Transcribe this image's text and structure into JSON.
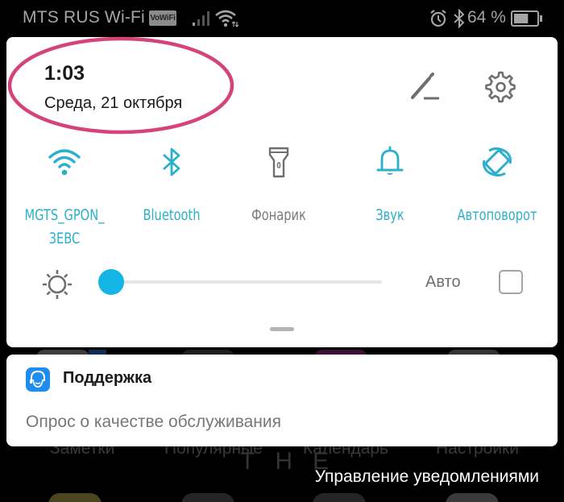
{
  "status_bar": {
    "carrier": "MTS RUS Wi-Fi",
    "vowifi_badge": "VoWiFi",
    "battery_percent_text": "64 %",
    "battery_level": 0.64,
    "icons": [
      "signal-icon",
      "wifi-icon",
      "alarm-icon",
      "bluetooth-icon",
      "battery-icon"
    ]
  },
  "quick_settings": {
    "time": "1:03",
    "date": "Среда, 21 октября",
    "edit_icon": "pencil-icon",
    "settings_icon": "gear-icon",
    "tiles": [
      {
        "label": "MGTS_GPON_\n3EBC",
        "icon": "wifi-icon",
        "active": true
      },
      {
        "label": "Bluetooth",
        "icon": "bluetooth-icon",
        "active": true
      },
      {
        "label": "Фонарик",
        "icon": "flashlight-icon",
        "active": false
      },
      {
        "label": "Звук",
        "icon": "bell-icon",
        "active": true
      },
      {
        "label": "Автоповорот",
        "icon": "auto-rotate-icon",
        "active": true
      }
    ],
    "brightness": {
      "icon": "sun-icon",
      "level": 0.0,
      "auto_label": "Авто",
      "auto_checked": false
    },
    "colors": {
      "accent": "#2ab0cc",
      "slider": "#12b5e3",
      "highlight": "#d4437a"
    }
  },
  "notification": {
    "app_name": "Поддержка",
    "app_icon": "support-headset-icon",
    "text": "Опрос о качестве обслуживания"
  },
  "background": {
    "app_labels": [
      "Заметки",
      "Популярные",
      "Календарь",
      "Настройки"
    ],
    "overlay_text": "THE"
  },
  "footer": {
    "manage_notifications": "Управление уведомлениями"
  }
}
